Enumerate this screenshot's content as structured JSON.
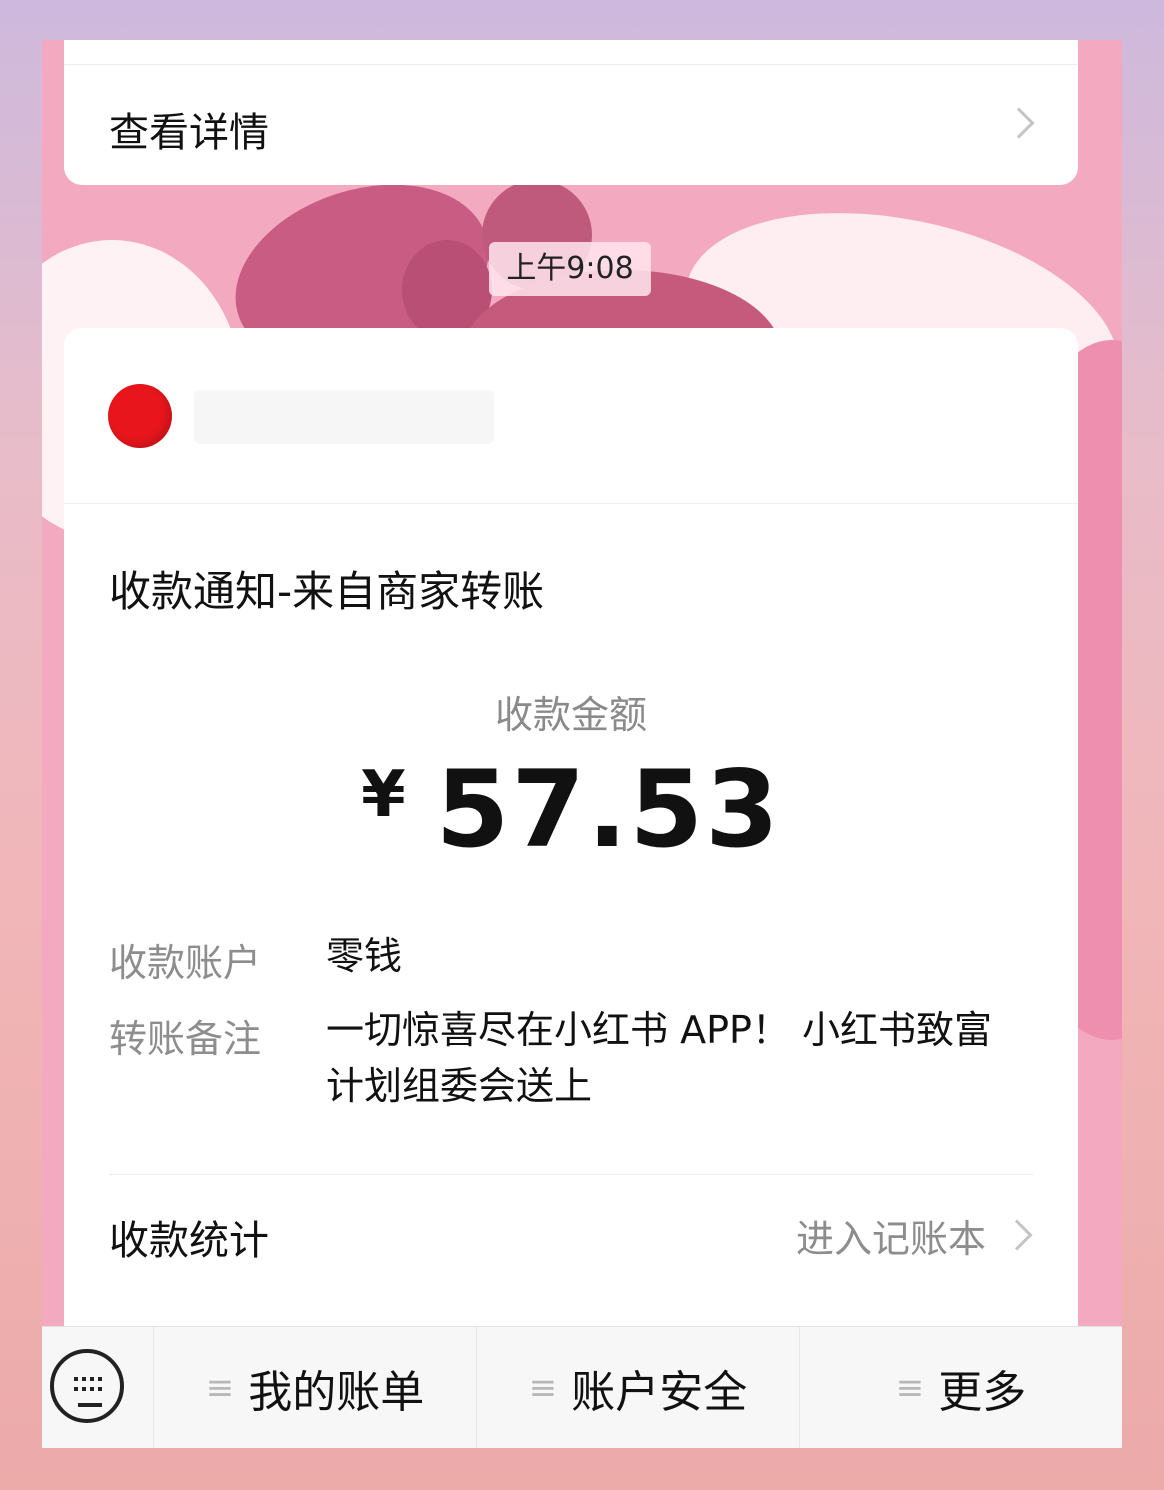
{
  "top_card": {
    "detail_label": "查看详情",
    "chevron_icon": "chevron-right-icon"
  },
  "timestamp": "上午9:08",
  "message": {
    "avatar_color": "#e8161c",
    "title": "收款通知-来自商家转账",
    "amount_label": "收款金额",
    "currency": "¥",
    "amount": "57.53",
    "fields": [
      {
        "label": "收款账户",
        "value": "零钱"
      },
      {
        "label": "转账备注",
        "value": "一切惊喜尽在小红书 APP！ 小红书致富计划组委会送上"
      }
    ],
    "stats_label": "收款统计",
    "ledger_link": "进入记账本"
  },
  "bottom_bar": {
    "keyboard_icon": "keyboard-icon",
    "menus": [
      "我的账单",
      "账户安全",
      "更多"
    ],
    "menu_icon": "≡"
  }
}
